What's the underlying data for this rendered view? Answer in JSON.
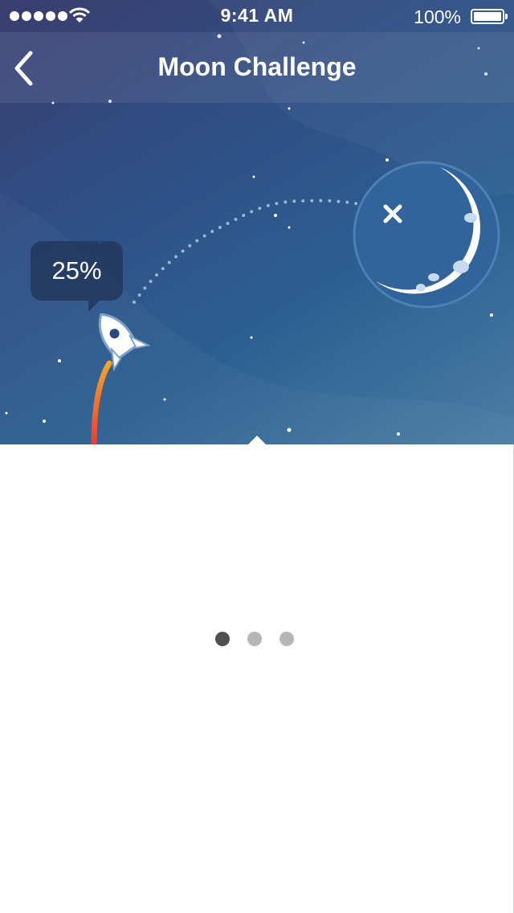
{
  "status_bar": {
    "time": "9:41 AM",
    "battery_percent": "100%",
    "signal_bars": 5,
    "battery_level": 1.0
  },
  "nav": {
    "title": "Moon Challenge",
    "back_icon": "chevron-left-icon"
  },
  "challenge": {
    "progress_label": "25%",
    "progress_value": 0.25,
    "rocket_icon": "rocket-icon",
    "moon_icon": "crescent-moon-icon",
    "target_icon": "x-mark-icon"
  },
  "pager": {
    "pages": 3,
    "current": 1
  },
  "colors": {
    "sky_top": "#3a3d6e",
    "sky_bottom": "#4a7ea5",
    "moon": "#ffffff",
    "moon_disc": "#2b5b8c",
    "flame_start": "#f7a32a",
    "flame_end": "#e8402a",
    "bubble": "#243a60",
    "page_dot_active": "#505050",
    "page_dot_inactive": "#b6b6b6"
  }
}
